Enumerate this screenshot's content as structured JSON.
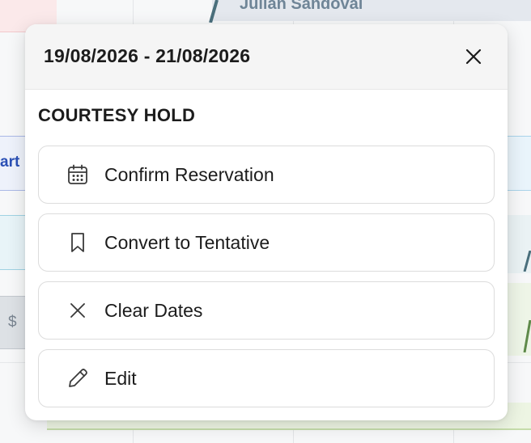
{
  "background": {
    "top_booking_name": "Julian Sandoval",
    "left_partial_label": "art",
    "left_currency_symbol": "$"
  },
  "popover": {
    "date_range": "19/08/2026 - 21/08/2026",
    "close_icon": "close-icon",
    "status": "COURTESY HOLD",
    "actions": [
      {
        "label": "Confirm Reservation",
        "icon": "calendar-icon"
      },
      {
        "label": "Convert to Tentative",
        "icon": "bookmark-icon"
      },
      {
        "label": "Clear Dates",
        "icon": "x-icon"
      },
      {
        "label": "Edit",
        "icon": "pencil-icon"
      }
    ]
  }
}
